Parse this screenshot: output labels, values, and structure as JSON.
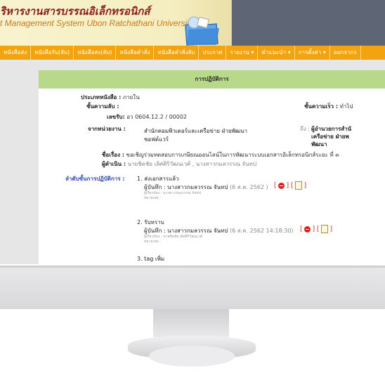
{
  "header": {
    "title_th": "ริหารงานสารบรรณอิเล็กทรอนิกส์",
    "title_en": "t Management System Ubon Ratchathani University"
  },
  "nav": [
    {
      "label": "หนังสือส่ง"
    },
    {
      "label": "หนังสือรับ(ลับ)"
    },
    {
      "label": "หนังสือส่ง(ลับ)"
    },
    {
      "label": "หนังสือคำสั่ง"
    },
    {
      "label": "หนังสือคำสั่งลับ"
    },
    {
      "label": "ประกาศ"
    },
    {
      "label": "รายงาน ▾"
    },
    {
      "label": "คำแนะนำ ▾"
    },
    {
      "label": "การตั้งค่า ▾"
    },
    {
      "label": "ออกจากร"
    }
  ],
  "panel": {
    "title": "การปฏิบัติการ",
    "doc_type_label": "ประเภทหนังสือ :",
    "doc_type_value": "ภายใน",
    "secret_label": "ชั้นความลับ :",
    "number_label": "เลขรับ:",
    "number_value": "อว 0604.12.2 / 00002",
    "urgency_label": "ชั้นความเร็ว :",
    "urgency_value": "ทำไป",
    "from_label": "จากหน่วยงาน :",
    "from_value_1": "สำนักคอมพิวเตอร์และเครือข่าย ฝ่ายพัฒนา",
    "from_value_2": "ซอฟต์แวร์",
    "to_label": "ถึง :",
    "to_value_1": "ผู้อำนวยการสำนั",
    "to_value_2": "เครือข่าย ฝ่ายพ",
    "to_value_3": "พัฒนา",
    "subject_label": "ชื่อเรื่อง :",
    "subject_value": "ขอเชิญร่วมทดสอบการเกษียณออนไลน์ในการพัฒนาระบบเอกสารอิเล็กทรอนิกส์ระยะ ที่ ๓",
    "actor_label": "ผู้ดำเนิน :",
    "actor_value": "นายชิดชัย เลิศศิริวัฒนเวศ์ , นางสาวกมลวรรณ จันทป",
    "steps_label": "ลำดับขั้นการปฏิบัติการ :",
    "steps": [
      {
        "title": "1. ส่งเอกสารแล้ว",
        "recorder": "ผู้บันทึก : นางสาวกมลวรรณ จันทป",
        "time": "(6 ส.ค. 2562 )",
        "to": "ผู้เกี่ยวข้อง : นางสาวกมลวรรณ จันทป",
        "note": "หมายเหตุ :"
      },
      {
        "title": "2. รับทราบ",
        "recorder": "ผู้บันทึก : นางสาวกมลวรรณ จันทป",
        "time": "(6 ส.ค. 2562  14:18:30)",
        "to": "ผู้เกี่ยวข้อง : นายชิดชัย เลิศศิริวัฒนเวศ์",
        "note": "หมายเหตุ :"
      },
      {
        "title": "3. tag เพิ่ม"
      }
    ]
  },
  "colors": {
    "nav": "#f2a30d",
    "panel_header": "#b8d98a",
    "header_dark": "#5e6675"
  }
}
